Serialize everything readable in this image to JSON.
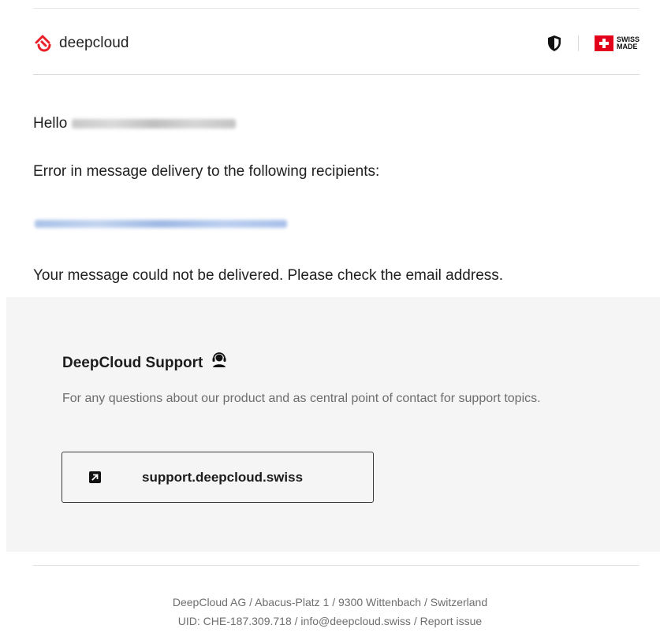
{
  "header": {
    "brand_name": "deepcloud",
    "brand_color": "#e8202a",
    "swiss_made_line1": "SWISS",
    "swiss_made_line2": "MADE",
    "swiss_red": "#e2001a"
  },
  "message": {
    "greeting": "Hello",
    "error_line": "Error in message delivery to the following recipients:",
    "instruction": "Your message could not be delivered. Please check the email address."
  },
  "support": {
    "title": "DeepCloud Support",
    "description": "For any questions about our product and as central point of contact for support topics.",
    "link_label": "support.deepcloud.swiss",
    "panel_bg": "#f5f5f5"
  },
  "footer": {
    "company": "DeepCloud AG",
    "street": "Abacus-Platz 1",
    "city": "9300 Wittenbach",
    "country": "Switzerland",
    "uid": "UID: CHE-187.309.718",
    "email": "info@deepcloud.swiss",
    "report": "Report issue",
    "separator": " / "
  },
  "icons": [
    "deepcloud-logo-icon",
    "shield-icon",
    "swiss-flag-icon",
    "support-agent-icon",
    "external-link-arrow-icon"
  ]
}
